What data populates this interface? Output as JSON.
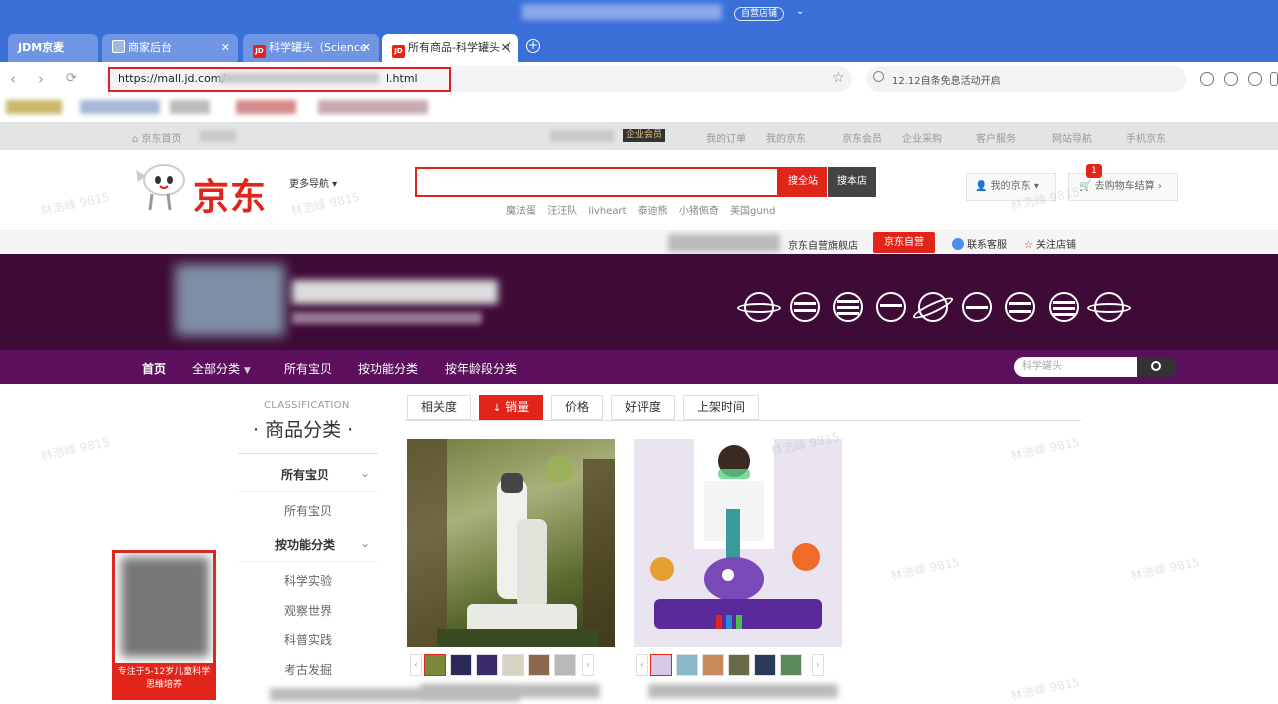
{
  "browser": {
    "titlebar": {
      "store_pill": "自营店铺"
    },
    "tabs": [
      {
        "label": "JDM京麦",
        "active": false
      },
      {
        "label": "商家后台",
        "active": false
      },
      {
        "label": "科学罐头（Science",
        "active": false
      },
      {
        "label": "所有商品-科学罐头（",
        "active": true
      }
    ],
    "address": {
      "url_start": "https://mall.jd.com/",
      "url_end": "l.html"
    },
    "search_placeholder": "12.12自条免息活动开启"
  },
  "shortcut": {
    "home": "京东首页",
    "vip": "企业会员",
    "items": [
      "我的订单",
      "我的京东",
      "京东会员",
      "企业采购",
      "客户服务",
      "网站导航",
      "手机京东"
    ]
  },
  "header": {
    "logo": "京东",
    "more_nav": "更多导航",
    "search_all": "搜全站",
    "search_store": "搜本店",
    "hotwords": [
      "魔法蛋",
      "汪汪队",
      "livheart",
      "泰迪熊",
      "小猪佩奇",
      "美国gund"
    ],
    "my_jd": "我的京东",
    "cart": "去购物车结算",
    "cart_count": "1"
  },
  "storebar": {
    "store_name": "京东自营旗舰店",
    "self_badge": "京东自营",
    "contact": "联系客服",
    "follow": "关注店铺"
  },
  "storenav": {
    "items": [
      "首页",
      "全部分类",
      "所有宝贝",
      "按功能分类",
      "按年龄段分类"
    ],
    "search_placeholder": "科学罐头"
  },
  "sidebar": {
    "title_en": "CLASSIFICATION",
    "title_cn": "· 商品分类 ·",
    "cat1": "所有宝贝",
    "cat1_items": [
      "所有宝贝"
    ],
    "cat2": "按功能分类",
    "cat2_items": [
      "科学实验",
      "观察世界",
      "科普实践",
      "考古发掘"
    ]
  },
  "qr_card": {
    "caption": "专注于5-12岁儿童科学思维培养"
  },
  "sort_tabs": [
    "相关度",
    "销量",
    "价格",
    "好评度",
    "上架时间"
  ],
  "sort_active": "销量",
  "watermark": "林浩峰 9815",
  "colors": {
    "jd_red": "#e1251b",
    "banner": "#3e0a36",
    "store_nav": "#5c0f5c",
    "browser_blue": "#3b6fd8"
  }
}
